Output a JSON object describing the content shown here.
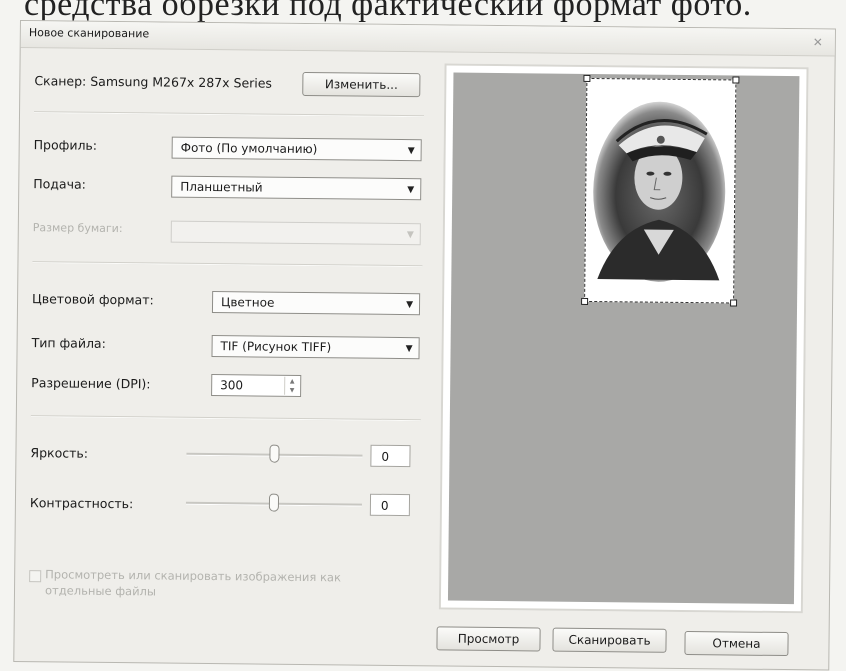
{
  "caption_text": "средства обрезки под фактический формат фото.",
  "window": {
    "title": "Новое сканирование",
    "close_glyph": "✕"
  },
  "scanner": {
    "label": "Сканер: Samsung M267x 287x Series",
    "change_button": "Изменить..."
  },
  "form": {
    "profile_label": "Профиль:",
    "profile_value": "Фото (По умолчанию)",
    "feed_label": "Подача:",
    "feed_value": "Планшетный",
    "paper_size_label": "Размер бумаги:",
    "paper_size_value": "",
    "color_format_label": "Цветовой формат:",
    "color_format_value": "Цветное",
    "file_type_label": "Тип файла:",
    "file_type_value": "TIF (Рисунок TIFF)",
    "resolution_label": "Разрешение (DPI):",
    "resolution_value": "300",
    "brightness_label": "Яркость:",
    "brightness_value": "0",
    "contrast_label": "Контрастность:",
    "contrast_value": "0",
    "separate_files_line1": "Просмотреть или сканировать изображения как",
    "separate_files_line2": "отдельные файлы"
  },
  "buttons": {
    "preview": "Просмотр",
    "scan": "Сканировать",
    "cancel": "Отмена"
  },
  "colors": {
    "preview_background": "#a8a8a6",
    "window_background": "#efeeea"
  }
}
